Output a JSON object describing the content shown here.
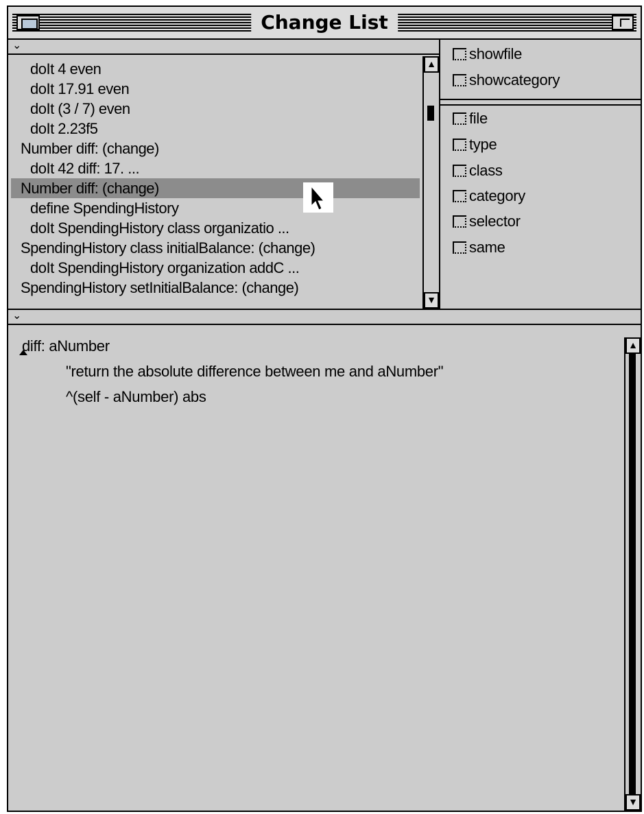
{
  "window": {
    "title": "Change List"
  },
  "change_list": {
    "items": [
      {
        "label": "doIt 4 even",
        "style": "indent"
      },
      {
        "label": "doIt 17.91 even",
        "style": "indent"
      },
      {
        "label": "doIt (3 / 7) even",
        "style": "indent"
      },
      {
        "label": "doIt 2.23f5",
        "style": "indent"
      },
      {
        "label": "Number diff: (change)",
        "style": "top"
      },
      {
        "label": "doIt 42 diff: 17. ...",
        "style": "indent"
      },
      {
        "label": "Number diff: (change)",
        "style": "top",
        "selected": true
      },
      {
        "label": "define SpendingHistory",
        "style": "indent"
      },
      {
        "label": "doIt SpendingHistory class organizatio ...",
        "style": "indent"
      },
      {
        "label": "SpendingHistory class initialBalance: (change)",
        "style": "top"
      },
      {
        "label": "doIt SpendingHistory organization addC ...",
        "style": "indent"
      },
      {
        "label": "SpendingHistory setInitialBalance: (change)",
        "style": "top"
      }
    ]
  },
  "display_options": {
    "showfile": "showfile",
    "showcategory": "showcategory"
  },
  "filters": {
    "file": "file",
    "type": "type",
    "class": "class",
    "category": "category",
    "selector": "selector",
    "same": "same"
  },
  "code": {
    "line1": "diff: aNumber",
    "line2": "\"return the absolute difference between me and aNumber\"",
    "line3": "^(self - aNumber) abs"
  },
  "icons": {
    "menu_arrow": "chevron-down-icon",
    "scroll_up": "arrow-up-icon",
    "scroll_down": "arrow-down-icon",
    "cursor": "mouse-pointer-icon"
  },
  "colors": {
    "window_bg": "#cccccc",
    "selection": "#8c8c8c",
    "border": "#000000"
  }
}
